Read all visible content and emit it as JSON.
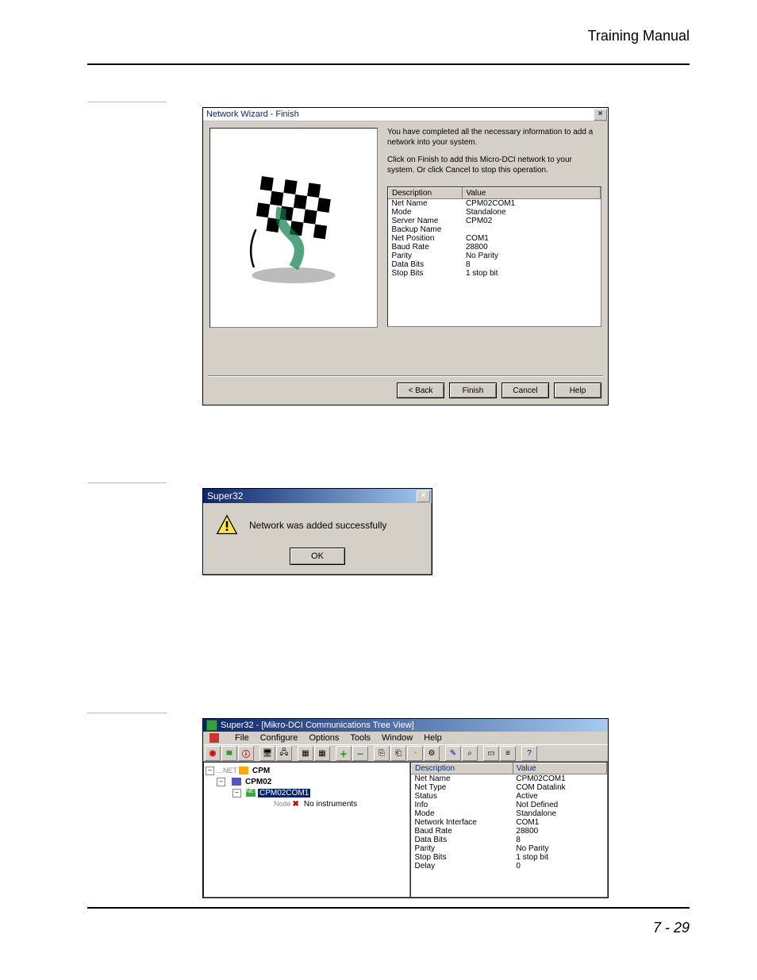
{
  "header": {
    "title": "Training Manual"
  },
  "footer": {
    "page": "7 - 29"
  },
  "wizard": {
    "title": "Network Wizard - Finish",
    "close": "×",
    "para1": "You have completed all the necessary information to add a network into your system.",
    "para2": "Click on Finish to add this Micro-DCI network to your system. Or click Cancel to stop this operation.",
    "col_desc": "Description",
    "col_value": "Value",
    "rows": [
      {
        "d": "Net Name",
        "v": "CPM02COM1"
      },
      {
        "d": "Mode",
        "v": "Standalone"
      },
      {
        "d": "Server Name",
        "v": "CPM02"
      },
      {
        "d": "Backup Name",
        "v": ""
      },
      {
        "d": "Net Position",
        "v": "COM1"
      },
      {
        "d": "Baud Rate",
        "v": "28800"
      },
      {
        "d": "Parity",
        "v": "No Parity"
      },
      {
        "d": "Data Bits",
        "v": "8"
      },
      {
        "d": "Stop Bits",
        "v": "1 stop bit"
      }
    ],
    "buttons": {
      "back": "< Back",
      "finish": "Finish",
      "cancel": "Cancel",
      "help": "Help"
    }
  },
  "msgbox": {
    "title": "Super32",
    "close": "×",
    "text": "Network was added successfully",
    "ok": "OK"
  },
  "treeview": {
    "title": "Super32 - [Mikro-DCI Communications Tree View]",
    "menu": {
      "file": "File",
      "configure": "Configure",
      "options": "Options",
      "tools": "Tools",
      "window": "Window",
      "help": "Help"
    },
    "toolbar_help": "?",
    "tree": {
      "root": "CPM",
      "server": "CPM02",
      "net_tag": "NET",
      "net": "CPM02COM1",
      "node_tag": "Node",
      "noinst": "No instruments"
    },
    "col_desc": "Description",
    "col_value": "Value",
    "rows": [
      {
        "d": "Net Name",
        "v": "CPM02COM1"
      },
      {
        "d": "Net Type",
        "v": "COM Datalink"
      },
      {
        "d": "Status",
        "v": "Active"
      },
      {
        "d": "Info",
        "v": "Not Defined"
      },
      {
        "d": "Mode",
        "v": "Standalone"
      },
      {
        "d": "Network Interface",
        "v": "COM1"
      },
      {
        "d": "Baud Rate",
        "v": "28800"
      },
      {
        "d": "Data Bits",
        "v": "8"
      },
      {
        "d": "Parity",
        "v": "No Parity"
      },
      {
        "d": "Stop Bits",
        "v": "1 stop bit"
      },
      {
        "d": "Delay",
        "v": "0"
      }
    ]
  }
}
